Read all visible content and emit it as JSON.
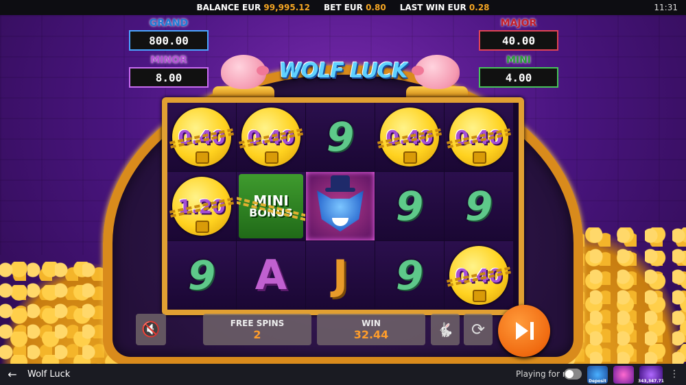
{
  "topbar": {
    "balance_label": "BALANCE EUR",
    "balance_value": "99,995.12",
    "bet_label": "BET EUR",
    "bet_value": "0.80",
    "last_win_label": "LAST WIN EUR",
    "last_win_value": "0.28",
    "clock": "11:31"
  },
  "jackpots": {
    "grand": {
      "label": "GRAND",
      "value": "800.00"
    },
    "minor": {
      "label": "MINOR",
      "value": "8.00"
    },
    "major": {
      "label": "MAJOR",
      "value": "40.00"
    },
    "mini": {
      "label": "MINI",
      "value": "4.00"
    }
  },
  "game_title": "WOLF LUCK",
  "reels": {
    "r1": [
      {
        "type": "coin",
        "text": "0.40"
      },
      {
        "type": "coin",
        "text": "1.20"
      },
      {
        "type": "nine",
        "text": "9"
      }
    ],
    "r2": [
      {
        "type": "coin",
        "text": "0.40"
      },
      {
        "type": "mini-bonus",
        "text1": "MINI",
        "text2": "BONUS"
      },
      {
        "type": "letter-a",
        "text": "A"
      }
    ],
    "r3": [
      {
        "type": "nine",
        "text": "9"
      },
      {
        "type": "wolf"
      },
      {
        "type": "letter-j",
        "text": "J"
      }
    ],
    "r4": [
      {
        "type": "coin",
        "text": "0.40"
      },
      {
        "type": "nine",
        "text": "9"
      },
      {
        "type": "nine",
        "text": "9"
      }
    ],
    "r5": [
      {
        "type": "coin",
        "text": "0.40"
      },
      {
        "type": "nine",
        "text": "9"
      },
      {
        "type": "coin",
        "text": "0.40"
      }
    ]
  },
  "controls": {
    "free_spins_label": "FREE SPINS",
    "free_spins_value": "2",
    "win_label": "WIN",
    "win_value": "32.44"
  },
  "footer": {
    "game_name": "Wolf Luck",
    "playing_for_real": "Playing for real",
    "promo_bonus": "Deposit",
    "promo_jackpot": "343,347.71"
  },
  "colors": {
    "accent_orange": "#f06a10",
    "value_orange": "#ff9d2a",
    "grand": "#1f7bd6",
    "minor": "#b54fd6",
    "major": "#c31e2a",
    "mini": "#2a9c3a"
  },
  "icons": [
    "mute-icon",
    "rabbit-icon",
    "autoplay-icon",
    "skip-play-icon",
    "back-arrow-icon",
    "more-icon"
  ]
}
